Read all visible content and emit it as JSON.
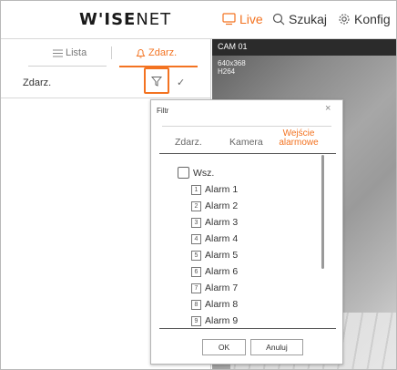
{
  "app": {
    "logo_bold": "W'ISE",
    "logo_light": "NET"
  },
  "nav": {
    "live": "Live",
    "search": "Szukaj",
    "config": "Konfig"
  },
  "left_panel": {
    "tabs": {
      "list": "Lista",
      "event": "Zdarz."
    },
    "event_label": "Zdarz.",
    "check_mark": "✓"
  },
  "video": {
    "camera": "CAM 01",
    "resolution": "640x368",
    "codec": "H264"
  },
  "filter_dialog": {
    "title": "Filtr",
    "close": "×",
    "tabs": {
      "event": "Zdarz.",
      "camera": "Kamera",
      "alarm_input_line1": "Wejście",
      "alarm_input_line2": "alarmowe"
    },
    "select_all": "Wsz.",
    "alarms": [
      {
        "num": "1",
        "label": "Alarm 1"
      },
      {
        "num": "2",
        "label": "Alarm 2"
      },
      {
        "num": "3",
        "label": "Alarm 3"
      },
      {
        "num": "4",
        "label": "Alarm 4"
      },
      {
        "num": "5",
        "label": "Alarm 5"
      },
      {
        "num": "6",
        "label": "Alarm 6"
      },
      {
        "num": "7",
        "label": "Alarm 7"
      },
      {
        "num": "8",
        "label": "Alarm 8"
      },
      {
        "num": "9",
        "label": "Alarm 9"
      }
    ],
    "ok": "OK",
    "cancel": "Anuluj"
  },
  "colors": {
    "accent": "#f37321",
    "header_dark": "#2b2b2b"
  }
}
